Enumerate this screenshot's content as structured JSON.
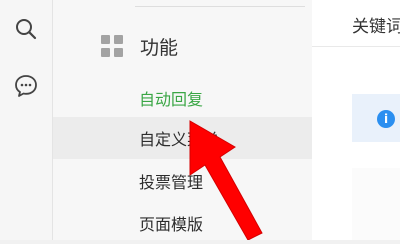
{
  "rail": {
    "icons": [
      "search-icon",
      "chat-icon"
    ]
  },
  "nav": {
    "section_title": "功能",
    "items": [
      {
        "label": "自动回复",
        "state": "active"
      },
      {
        "label": "自定义菜单",
        "state": "hover"
      },
      {
        "label": "投票管理",
        "state": "normal"
      },
      {
        "label": "页面模版",
        "state": "normal"
      }
    ]
  },
  "main": {
    "title": "关键词"
  },
  "colors": {
    "active_text": "#3aa645",
    "info_blue": "#2b8ff0",
    "arrow_red": "#ff0000"
  }
}
